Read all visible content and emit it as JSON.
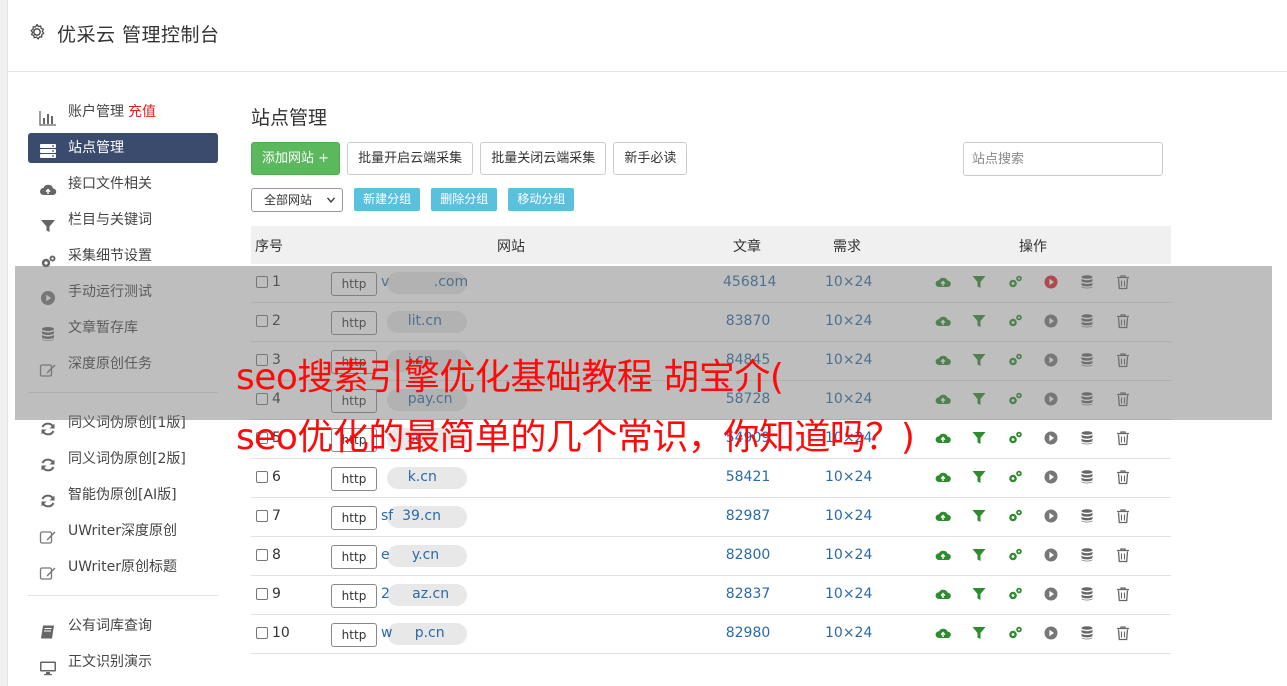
{
  "app": {
    "title": "优采云 管理控制台"
  },
  "sidebar": {
    "groups": [
      [
        {
          "label": "账户管理",
          "extra": "充值",
          "icon": "bar-chart-icon"
        },
        {
          "label": "站点管理",
          "icon": "server-icon",
          "active": true
        },
        {
          "label": "接口文件相关",
          "icon": "cloud-upload-icon"
        },
        {
          "label": "栏目与关键词",
          "icon": "filter-icon"
        },
        {
          "label": "采集细节设置",
          "icon": "cogs-icon"
        },
        {
          "label": "手动运行测试",
          "icon": "play-circle-icon"
        },
        {
          "label": "文章暂存库",
          "icon": "database-icon"
        },
        {
          "label": "深度原创任务",
          "icon": "edit-icon"
        }
      ],
      [
        {
          "label": "同义词伪原创[1版]",
          "icon": "refresh-icon"
        },
        {
          "label": "同义词伪原创[2版]",
          "icon": "refresh-icon"
        },
        {
          "label": "智能伪原创[AI版]",
          "icon": "refresh-icon"
        },
        {
          "label": "UWriter深度原创",
          "icon": "edit-icon"
        },
        {
          "label": "UWriter原创标题",
          "icon": "edit-icon"
        }
      ],
      [
        {
          "label": "公有词库查询",
          "icon": "book-icon"
        },
        {
          "label": "正文识别演示",
          "icon": "monitor-icon"
        }
      ]
    ]
  },
  "main": {
    "title": "站点管理",
    "buttons": {
      "add": "添加网站 +",
      "batch_on": "批量开启云端采集",
      "batch_off": "批量关闭云端采集",
      "guide": "新手必读"
    },
    "search_placeholder": "站点搜索",
    "filter": {
      "selected": "全部网站"
    },
    "group_buttons": {
      "new": "新建分组",
      "delete": "删除分组",
      "move": "移动分组"
    },
    "table": {
      "headers": {
        "no": "序号",
        "site": "网站",
        "articles": "文章",
        "demand": "需求",
        "ops": "操作"
      },
      "http_label": "http",
      "rows": [
        {
          "no": "1",
          "site": "v          .com",
          "articles": "456814",
          "demand": "10×24",
          "running": true
        },
        {
          "no": "2",
          "site": "      lit.cn",
          "articles": "83870",
          "demand": "10×24"
        },
        {
          "no": "3",
          "site": "      i.cn",
          "articles": "84845",
          "demand": "10×24"
        },
        {
          "no": "4",
          "site": "      pay.cn",
          "articles": "58728",
          "demand": "10×24"
        },
        {
          "no": "5",
          "site": "      sc",
          "articles": "54909",
          "demand": "10×24"
        },
        {
          "no": "6",
          "site": "      k.cn",
          "articles": "58421",
          "demand": "10×24"
        },
        {
          "no": "7",
          "site": "sf  39.cn",
          "articles": "82987",
          "demand": "10×24"
        },
        {
          "no": "8",
          "site": "e     y.cn",
          "articles": "82800",
          "demand": "10×24"
        },
        {
          "no": "9",
          "site": "2     az.cn",
          "articles": "82837",
          "demand": "10×24"
        },
        {
          "no": "10",
          "site": "w     p.cn",
          "articles": "82980",
          "demand": "10×24"
        }
      ]
    }
  },
  "overlay": {
    "line1": "seo搜索引擎优化基础教程 胡宝介(",
    "line2": "seo优化的最简单的几个常识，你知道吗？)"
  },
  "colors": {
    "accent": "#3b4b6e",
    "green": "#5cb85c",
    "info": "#5bc0de",
    "link": "#2a6aa8",
    "caption": "#ff0a0a",
    "recharge": "#e02020"
  }
}
